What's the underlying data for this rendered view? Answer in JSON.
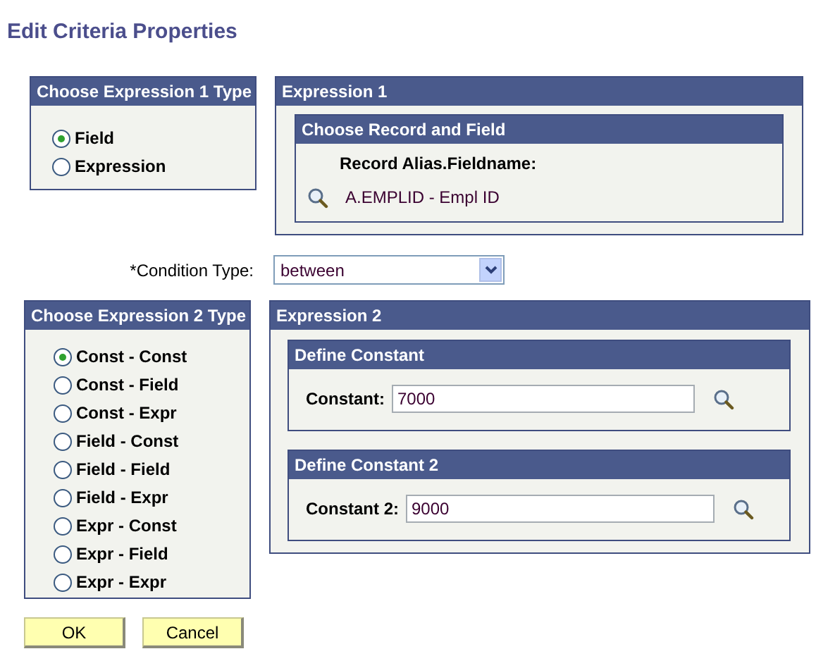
{
  "title": "Edit Criteria Properties",
  "expression1_type": {
    "heading": "Choose Expression 1 Type",
    "options": [
      {
        "label": "Field",
        "selected": true
      },
      {
        "label": "Expression",
        "selected": false
      }
    ]
  },
  "expression1": {
    "heading": "Expression 1",
    "section": {
      "heading": "Choose Record and Field",
      "label": "Record Alias.Fieldname:",
      "value": "A.EMPLID - Empl ID"
    }
  },
  "condition_type": {
    "label": "*Condition Type:",
    "value": "between"
  },
  "expression2_type": {
    "heading": "Choose Expression 2 Type",
    "options": [
      {
        "label": "Const - Const",
        "selected": true
      },
      {
        "label": "Const - Field",
        "selected": false
      },
      {
        "label": "Const - Expr",
        "selected": false
      },
      {
        "label": "Field - Const",
        "selected": false
      },
      {
        "label": "Field - Field",
        "selected": false
      },
      {
        "label": "Field - Expr",
        "selected": false
      },
      {
        "label": "Expr - Const",
        "selected": false
      },
      {
        "label": "Expr - Field",
        "selected": false
      },
      {
        "label": "Expr - Expr",
        "selected": false
      }
    ]
  },
  "expression2": {
    "heading": "Expression 2",
    "sections": [
      {
        "heading": "Define Constant",
        "label": "Constant:",
        "value": "7000"
      },
      {
        "heading": "Define Constant 2",
        "label": "Constant 2:",
        "value": "9000"
      }
    ]
  },
  "buttons": [
    "OK",
    "Cancel"
  ]
}
